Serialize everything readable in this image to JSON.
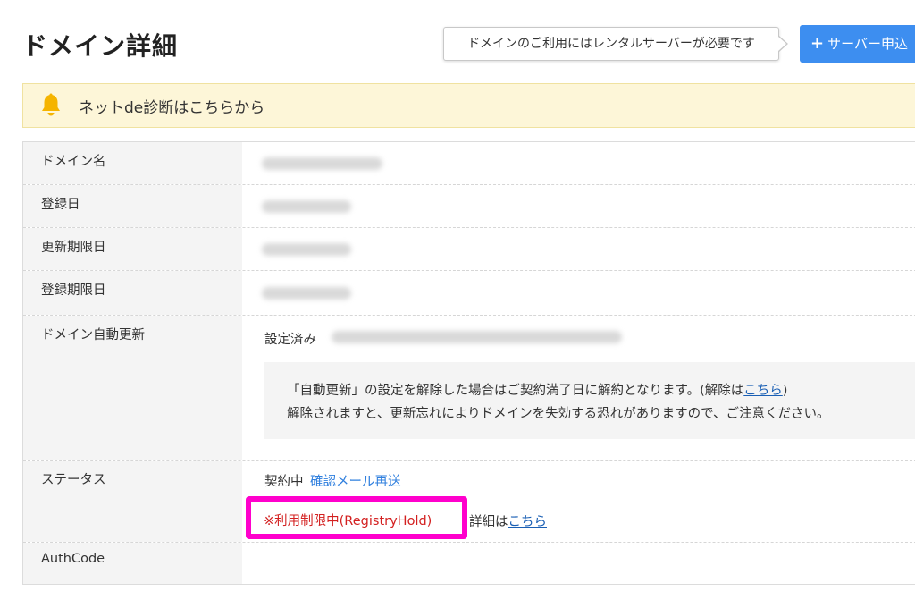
{
  "page": {
    "title": "ドメイン詳細"
  },
  "header": {
    "tooltip": "ドメインのご利用にはレンタルサーバーが必要です",
    "server_button_plus": "+",
    "server_button_label": "サーバー申込"
  },
  "notice": {
    "icon": "bell-icon",
    "link_text": "ネットde診断はこちらから"
  },
  "table": {
    "rows": [
      {
        "label": "ドメイン名"
      },
      {
        "label": "登録日"
      },
      {
        "label": "更新期限日"
      },
      {
        "label": "登録期限日"
      },
      {
        "label": "ドメイン自動更新"
      },
      {
        "label": "ステータス"
      },
      {
        "label": "AuthCode"
      }
    ],
    "auto_renew": {
      "status": "設定済み",
      "info_line1_pre": "「自動更新」の設定を解除した場合はご契約満了日に解約となります。(解除は",
      "info_line1_link": "こちら",
      "info_line1_post": ")",
      "info_line2": "解除されますと、更新忘れによりドメインを失効する恐れがありますので、ご注意ください。"
    },
    "status": {
      "contract": "契約中",
      "resend_link": "確認メール再送",
      "restriction": "※利用制限中(RegistryHold)",
      "details_pre": "詳細は",
      "details_link": "こちら"
    }
  },
  "colors": {
    "accent_blue": "#3d8ef0",
    "link_blue": "#2f7fde",
    "warning_red": "#d32020",
    "highlight_magenta": "#ff00cc",
    "notice_bg": "#fdf6d8"
  }
}
